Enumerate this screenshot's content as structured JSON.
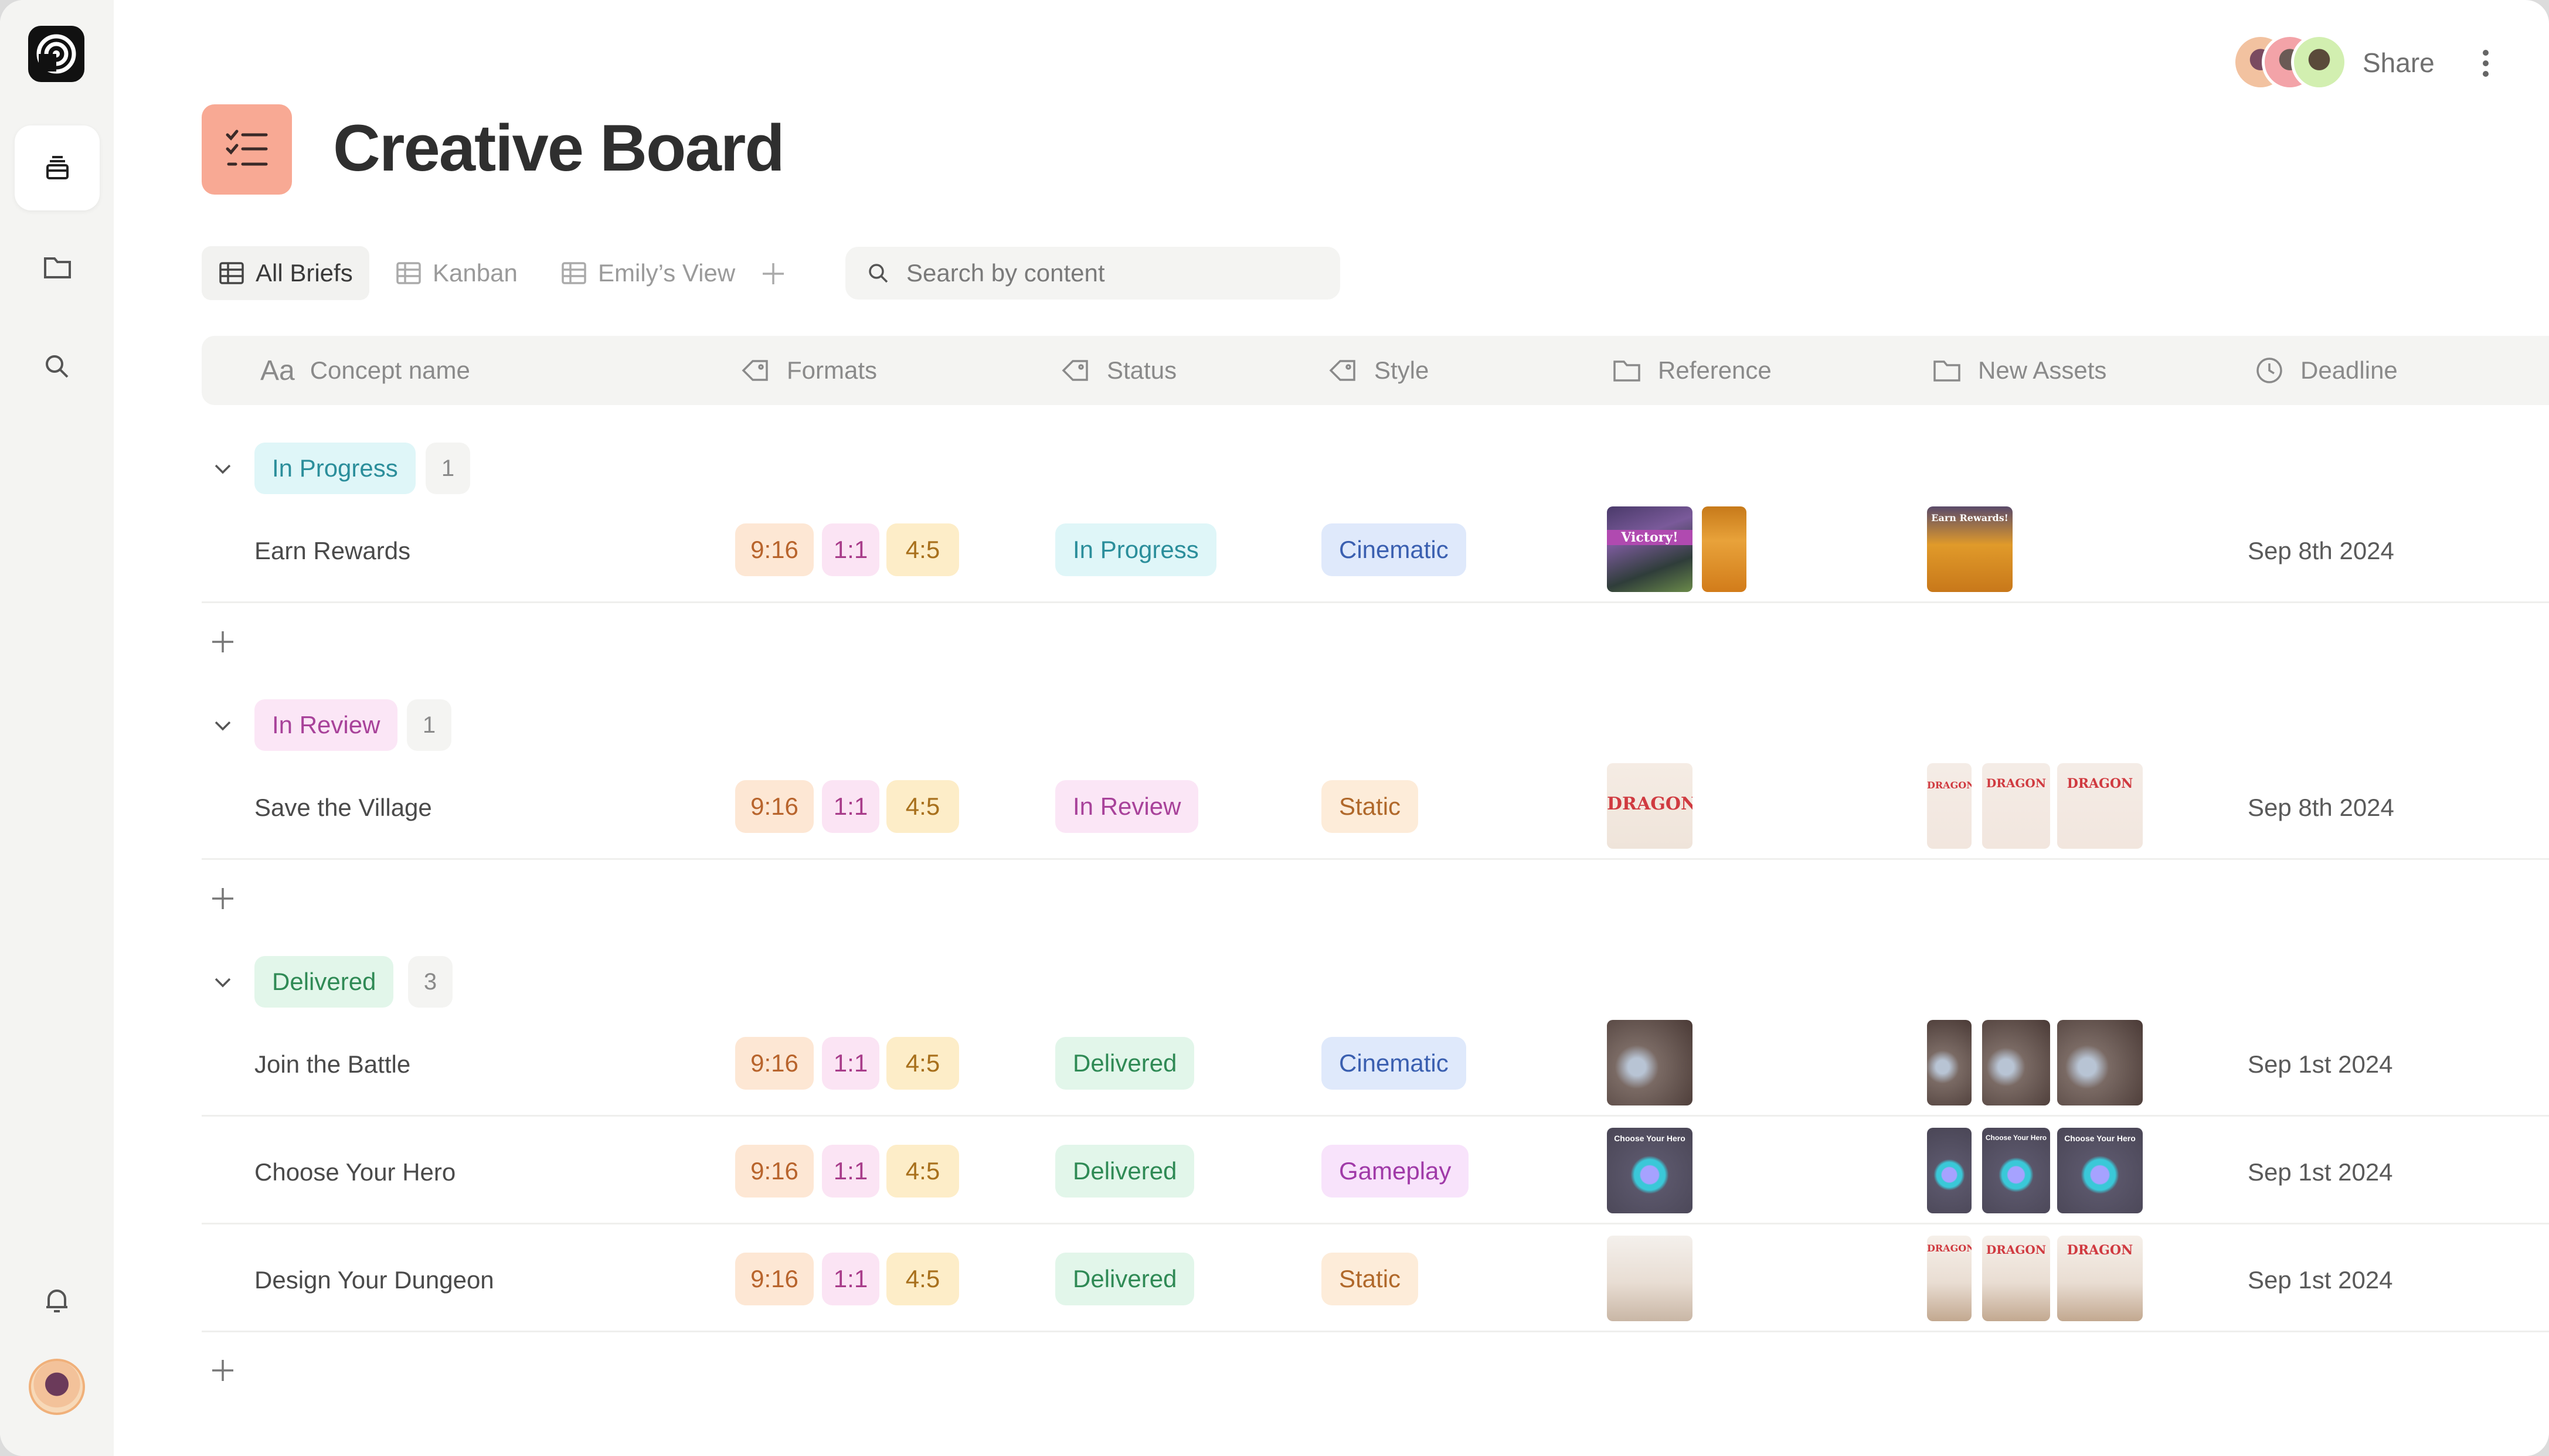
{
  "page": {
    "title": "Creative Board"
  },
  "topbar": {
    "share_label": "Share"
  },
  "views": {
    "tabs": [
      {
        "label": "All Briefs",
        "active": true
      },
      {
        "label": "Kanban",
        "active": false
      },
      {
        "label": "Emily’s View",
        "active": false
      }
    ]
  },
  "search": {
    "placeholder": "Search by content",
    "value": ""
  },
  "columns": {
    "concept_prefix": "Aa",
    "concept": "Concept name",
    "formats": "Formats",
    "status": "Status",
    "style": "Style",
    "reference": "Reference",
    "new_assets": "New Assets",
    "deadline": "Deadline"
  },
  "formats": [
    "9:16",
    "1:1",
    "4:5"
  ],
  "groups": [
    {
      "label": "In Progress",
      "count": "1",
      "colors": {
        "bg": "#dff6f8",
        "fg": "#2b8e9b"
      },
      "rows": [
        {
          "name": "Earn Rewards",
          "status": "In Progress",
          "style": "Cinematic",
          "deadline": "Sep 8th 2024",
          "reference_thumbs": [
            "victory-screenshot",
            "gold-coins-thumb"
          ],
          "asset_thumbs": [
            "earn-rewards-thumb"
          ],
          "reference_texts": [
            "Victory!"
          ],
          "asset_texts": [
            "Earn Rewards!"
          ]
        }
      ]
    },
    {
      "label": "In Review",
      "count": "1",
      "colors": {
        "bg": "#fbe6f6",
        "fg": "#a8429a"
      },
      "rows": [
        {
          "name": "Save the Village",
          "status": "In Review",
          "style": "Static",
          "deadline": "Sep 8th 2024",
          "reference_thumbs": [
            "dragon-logo-thumb"
          ],
          "asset_thumbs": [
            "dragon-logo-thumb",
            "dragon-logo-thumb",
            "dragon-logo-thumb"
          ],
          "reference_texts": [
            "DRAGON"
          ],
          "asset_texts": [
            "DRAGON",
            "DRAGON",
            "DRAGON"
          ]
        }
      ]
    },
    {
      "label": "Delivered",
      "count": "3",
      "colors": {
        "bg": "#e2f6ea",
        "fg": "#2f8a55"
      },
      "rows": [
        {
          "name": "Join the Battle",
          "status": "Delivered",
          "style": "Cinematic",
          "deadline": "Sep 1st 2024",
          "reference_thumbs": [
            "battle-thumb"
          ],
          "asset_thumbs": [
            "battle-thumb",
            "battle-thumb",
            "battle-thumb"
          ]
        },
        {
          "name": "Choose Your Hero",
          "status": "Delivered",
          "style": "Gameplay",
          "deadline": "Sep 1st 2024",
          "reference_thumbs": [
            "hero-thumb"
          ],
          "asset_thumbs": [
            "hero-thumb",
            "hero-thumb",
            "hero-thumb"
          ],
          "reference_texts": [
            "Choose Your Hero"
          ],
          "asset_texts": [
            "Choose Your Hero",
            "Choose Your Hero"
          ]
        },
        {
          "name": "Design Your Dungeon",
          "status": "Delivered",
          "style": "Static",
          "deadline": "Sep 1st 2024",
          "reference_thumbs": [
            "dungeon-thumb"
          ],
          "asset_thumbs": [
            "dungeon-thumb",
            "dungeon-thumb",
            "dungeon-thumb"
          ],
          "asset_texts": [
            "DRAGON",
            "DRAGON",
            "DRAGON"
          ]
        }
      ]
    }
  ],
  "style_colors": {
    "Cinematic": {
      "bg": "#dfe9fb",
      "fg": "#3a5fb0"
    },
    "Static": {
      "bg": "#fdecd9",
      "fg": "#b0682a"
    },
    "Gameplay": {
      "bg": "#f8e3fb",
      "fg": "#a03aa8"
    }
  },
  "icons": {
    "sidebar": [
      "app-logo-icon",
      "stack-icon",
      "folder-icon",
      "search-icon",
      "bell-icon"
    ],
    "header": [
      "checklist-icon"
    ],
    "columns": [
      "text-icon",
      "tag-icon",
      "tag-icon",
      "tag-icon",
      "folder-icon",
      "folder-icon",
      "clock-icon"
    ]
  }
}
